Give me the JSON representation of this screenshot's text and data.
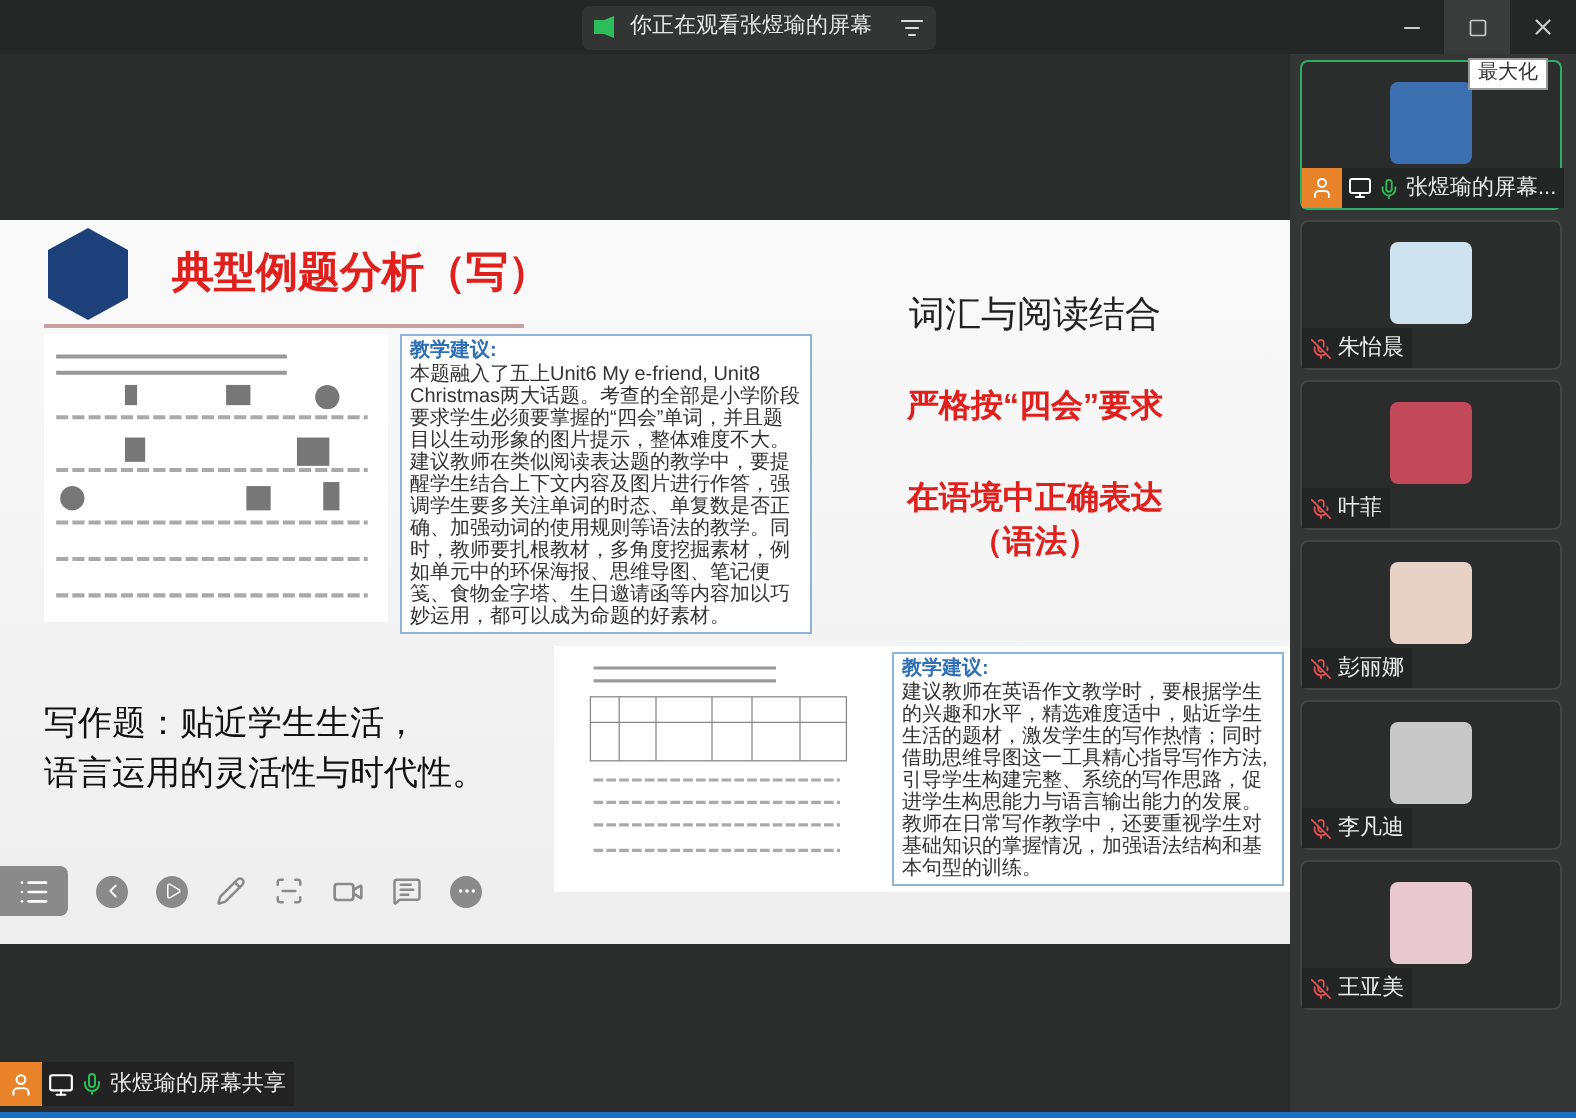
{
  "title_bar": {
    "sharing_text": "你正在观看张煜瑜的屏幕",
    "tooltip": "最大化"
  },
  "slide": {
    "title": "典型例题分析（写）",
    "suggestion_boxes": [
      {
        "heading": "教学建议:",
        "body": "本题融入了五上Unit6 My e-friend, Unit8 Christmas两大话题。考查的全部是小学阶段要求学生必须要掌握的“四会”单词，并且题目以生动形象的图片提示，整体难度不大。建议教师在类似阅读表达题的教学中，要提醒学生结合上下文内容及图片进行作答，强调学生要多关注单词的时态、单复数是否正确、加强动词的使用规则等语法的教学。同时，教师要扎根教材，多角度挖掘素材，例如单元中的环保海报、思维导图、笔记便笺、食物金字塔、生日邀请函等内容加以巧妙运用，都可以成为命题的好素材。"
      },
      {
        "heading": "教学建议:",
        "body": "建议教师在英语作文教学时，要根据学生的兴趣和水平，精选难度适中，贴近学生生活的题材，激发学生的写作热情；同时借助思维导图这一工具精心指导写作方法,引导学生构建完整、系统的写作思路，促进学生构思能力与语言输出能力的发展。教师在日常写作教学中，还要重视学生对基础知识的掌握情况，加强语法结构和基本句型的训练。"
      }
    ],
    "points": [
      {
        "text": "词汇与阅读结合",
        "kind": "plain"
      },
      {
        "text": "严格按“四会”要求",
        "kind": "accent"
      },
      {
        "text": "在语境中正确表达",
        "kind": "accent"
      },
      {
        "text": "（语法）",
        "kind": "accent"
      }
    ],
    "writing_lines": [
      "写作题：贴近学生生活，",
      "语言运用的灵活性与时代性。"
    ]
  },
  "participants": [
    {
      "name": "张煜瑜的屏幕...",
      "selected": true,
      "sharing": true,
      "muted": false,
      "color": "#3b6fb0"
    },
    {
      "name": "朱怡晨",
      "selected": false,
      "sharing": false,
      "muted": true,
      "color": "#cfe3ee"
    },
    {
      "name": "叶菲",
      "selected": false,
      "sharing": false,
      "muted": true,
      "color": "#c24a5a"
    },
    {
      "name": "彭丽娜",
      "selected": false,
      "sharing": false,
      "muted": true,
      "color": "#e8d2c8"
    },
    {
      "name": "李凡迪",
      "selected": false,
      "sharing": false,
      "muted": true,
      "color": "#c8c8c8"
    },
    {
      "name": "王亚美",
      "selected": false,
      "sharing": false,
      "muted": true,
      "color": "#e9c9d0"
    }
  ],
  "presenter_label": "张煜瑜的屏幕共享"
}
